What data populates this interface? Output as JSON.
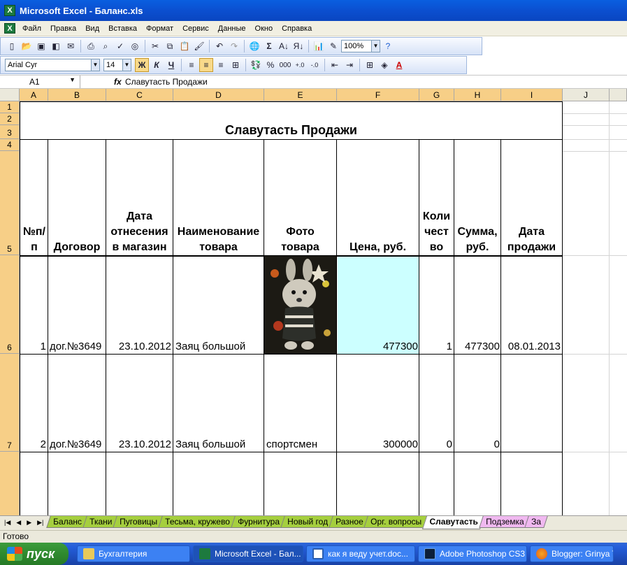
{
  "window": {
    "title": "Microsoft Excel - Баланс.xls"
  },
  "menu": [
    "Файл",
    "Правка",
    "Вид",
    "Вставка",
    "Формат",
    "Сервис",
    "Данные",
    "Окно",
    "Справка"
  ],
  "toolbar": {
    "zoom": "100%",
    "font": "Arial Cyr",
    "font_size": "14",
    "bold_label": "Ж",
    "italic_label": "К",
    "underline_label": "Ч",
    "percent_label": "%",
    "thousands_label": "000"
  },
  "formula": {
    "cell_ref": "A1",
    "fx_label": "fx",
    "content": "Славутасть Продажи"
  },
  "columns": [
    "A",
    "B",
    "C",
    "D",
    "E",
    "F",
    "G",
    "H",
    "I",
    "J"
  ],
  "rows": [
    "1",
    "2",
    "3",
    "4",
    "5",
    "6",
    "7"
  ],
  "sheet": {
    "title": "Славутасть Продажи",
    "headers": {
      "num": "№п/п",
      "contract": "Договор",
      "date": [
        "Дата",
        "отнесения",
        "в магазин"
      ],
      "name": [
        "Наименование",
        "товара"
      ],
      "photo": [
        "Фото",
        "товара"
      ],
      "price": "Цена, руб.",
      "qty": [
        "Коли",
        "чест",
        "во"
      ],
      "sum": [
        "Сумма,",
        "руб."
      ],
      "sale": [
        "Дата",
        "продажи"
      ]
    },
    "data": [
      {
        "num": "1",
        "contract": "дог.№3649",
        "date": "23.10.2012",
        "name": "Заяц большой",
        "photo": "",
        "price": "477300",
        "qty": "1",
        "sum": "477300",
        "sale": "08.01.2013"
      },
      {
        "num": "2",
        "contract": "дог.№3649",
        "date": "23.10.2012",
        "name": "Заяц большой",
        "photo": "спортсмен",
        "price": "300000",
        "qty": "0",
        "sum": "0",
        "sale": ""
      }
    ]
  },
  "tabs": [
    "Баланс",
    "Ткани",
    "Пуговицы",
    "Тесьма, кружево",
    "Фурнитура",
    "Новый год",
    "Разное",
    "Орг. вопросы",
    "Славутасть",
    "Подземка",
    "За"
  ],
  "status": "Готово",
  "taskbar": {
    "start": "пуск",
    "items": [
      "Бухгалтерия",
      "Microsoft Excel - Бал...",
      "как я веду учет.doc...",
      "Adobe Photoshop CS3",
      "Blogger: Grinya To"
    ]
  },
  "colors": {
    "header_orange": "#f7cf87",
    "price_fill": "#ccffff",
    "tab_green": "#a5cf3e",
    "tab_pink": "#f0b8f0"
  }
}
